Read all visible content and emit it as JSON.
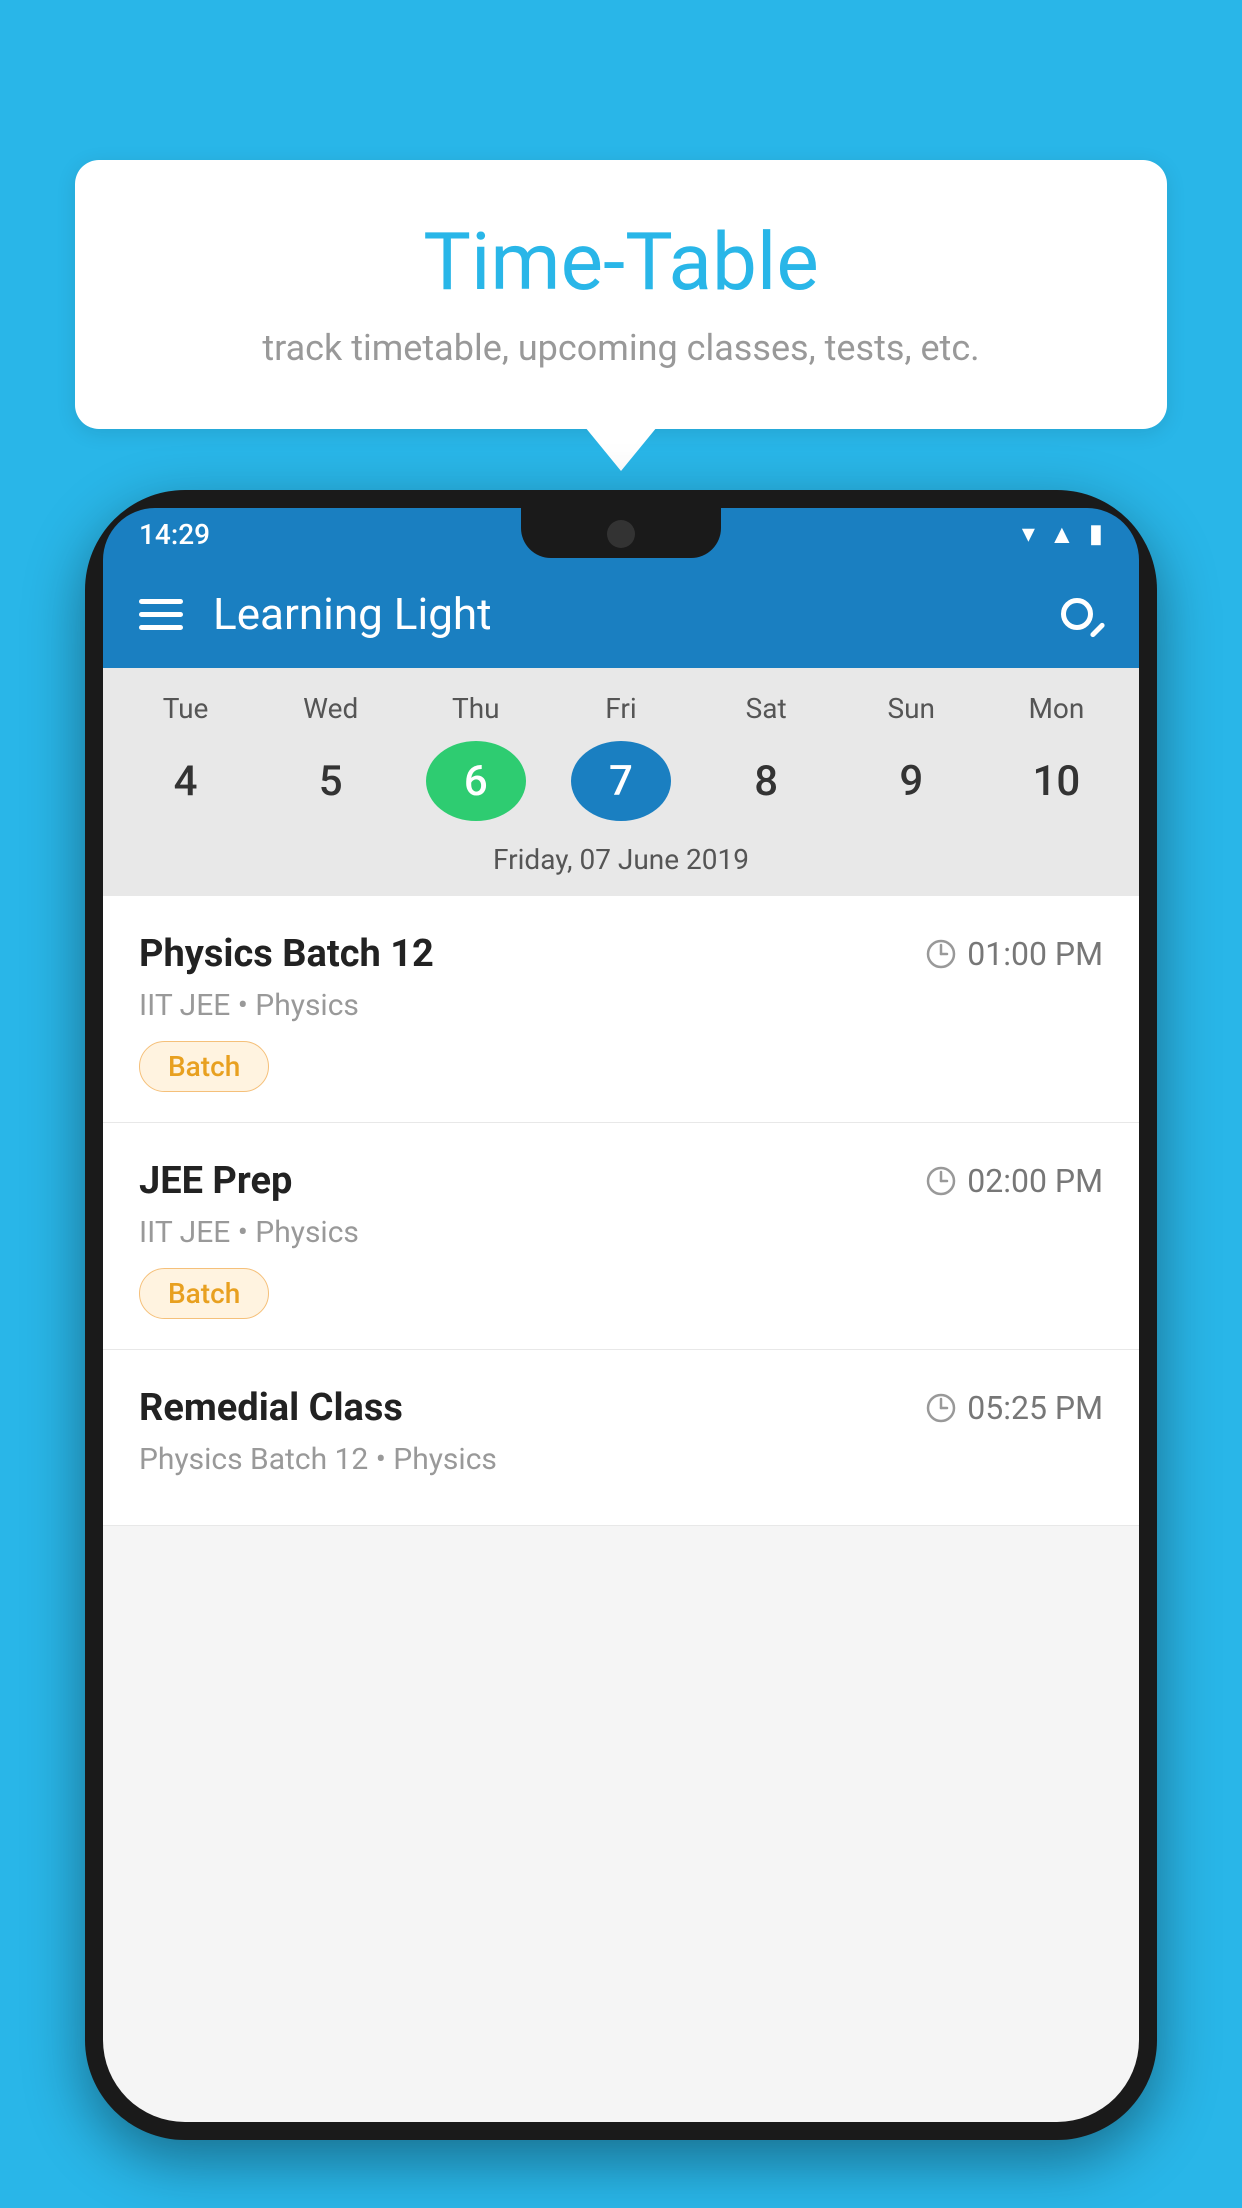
{
  "background": {
    "color": "#29b6e8"
  },
  "speech_bubble": {
    "title": "Time-Table",
    "subtitle": "track timetable, upcoming classes, tests, etc."
  },
  "status_bar": {
    "time": "14:29"
  },
  "app_bar": {
    "title": "Learning Light"
  },
  "calendar": {
    "days": [
      {
        "label": "Tue",
        "number": "4"
      },
      {
        "label": "Wed",
        "number": "5"
      },
      {
        "label": "Thu",
        "number": "6",
        "state": "today"
      },
      {
        "label": "Fri",
        "number": "7",
        "state": "selected"
      },
      {
        "label": "Sat",
        "number": "8"
      },
      {
        "label": "Sun",
        "number": "9"
      },
      {
        "label": "Mon",
        "number": "10"
      }
    ],
    "selected_date_label": "Friday, 07 June 2019"
  },
  "schedule_items": [
    {
      "title": "Physics Batch 12",
      "time": "01:00 PM",
      "subject": "IIT JEE • Physics",
      "badge": "Batch"
    },
    {
      "title": "JEE Prep",
      "time": "02:00 PM",
      "subject": "IIT JEE • Physics",
      "badge": "Batch"
    },
    {
      "title": "Remedial Class",
      "time": "05:25 PM",
      "subject": "Physics Batch 12 • Physics",
      "badge": null
    }
  ]
}
